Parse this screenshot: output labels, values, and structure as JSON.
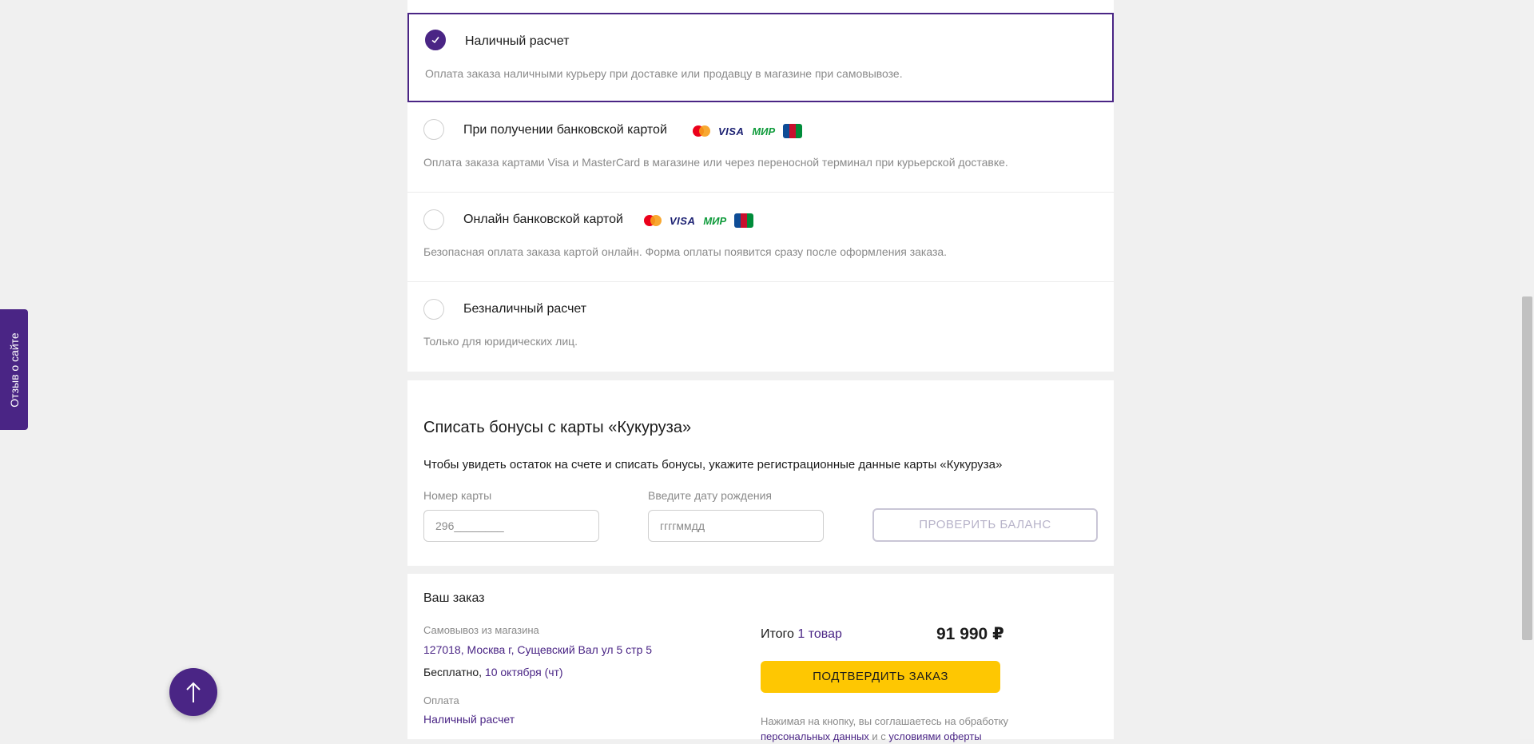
{
  "payment": {
    "options": [
      {
        "title": "Наличный расчет",
        "description": "Оплата заказа наличными курьеру при доставке или продавцу в магазине при самовывозе.",
        "selected": true
      },
      {
        "title": "При получении банковской картой",
        "description": "Оплата заказа картами Visa и MasterCard в магазине или через переносной терминал при курьерской доставке.",
        "selected": false
      },
      {
        "title": "Онлайн банковской картой",
        "description": "Безопасная оплата заказа картой онлайн. Форма оплаты появится сразу после оформления заказа.",
        "selected": false
      },
      {
        "title": "Безналичный расчет",
        "description": "Только для юридических лиц.",
        "selected": false
      }
    ],
    "card_logos": {
      "visa": "VISA",
      "mir": "МИР",
      "jcb": "JCB"
    }
  },
  "bonus": {
    "title": "Списать бонусы с карты «Кукуруза»",
    "subtitle": "Чтобы увидеть остаток на счете и списать бонусы, укажите регистрационные данные карты «Кукуруза»",
    "card_number_label": "Номер карты",
    "card_number_value": "296________",
    "birthdate_label": "Введите дату рождения",
    "birthdate_placeholder": "ггггммдд",
    "check_button": "ПРОВЕРИТЬ БАЛАНС"
  },
  "order": {
    "title": "Ваш заказ",
    "pickup_label": "Самовывоз из магазина",
    "address": "127018, Москва г, Сущевский Вал ул 5 стр 5",
    "delivery_price": "Бесплатно,",
    "delivery_date": "10 октября (чт)",
    "payment_label": "Оплата",
    "payment_value": "Наличный расчет",
    "total_label": "Итого",
    "total_items": "1 товар",
    "total_price": "91 990 ₽",
    "confirm_button": "ПОДТВЕРДИТЬ ЗАКАЗ",
    "agree_text": "Нажимая на кнопку, вы соглашаетесь на обработку",
    "agree_link1": "персональных данных",
    "agree_and": "и с",
    "agree_link2": "условиями оферты"
  },
  "feedback_tab": "Отзыв о сайте",
  "colors": {
    "accent": "#4a2585",
    "button_yellow": "#fec702",
    "muted": "#8a8a8a",
    "background": "#f0f0f0"
  },
  "icons": {
    "check": "check-icon",
    "arrow_up": "arrow-up-icon"
  }
}
